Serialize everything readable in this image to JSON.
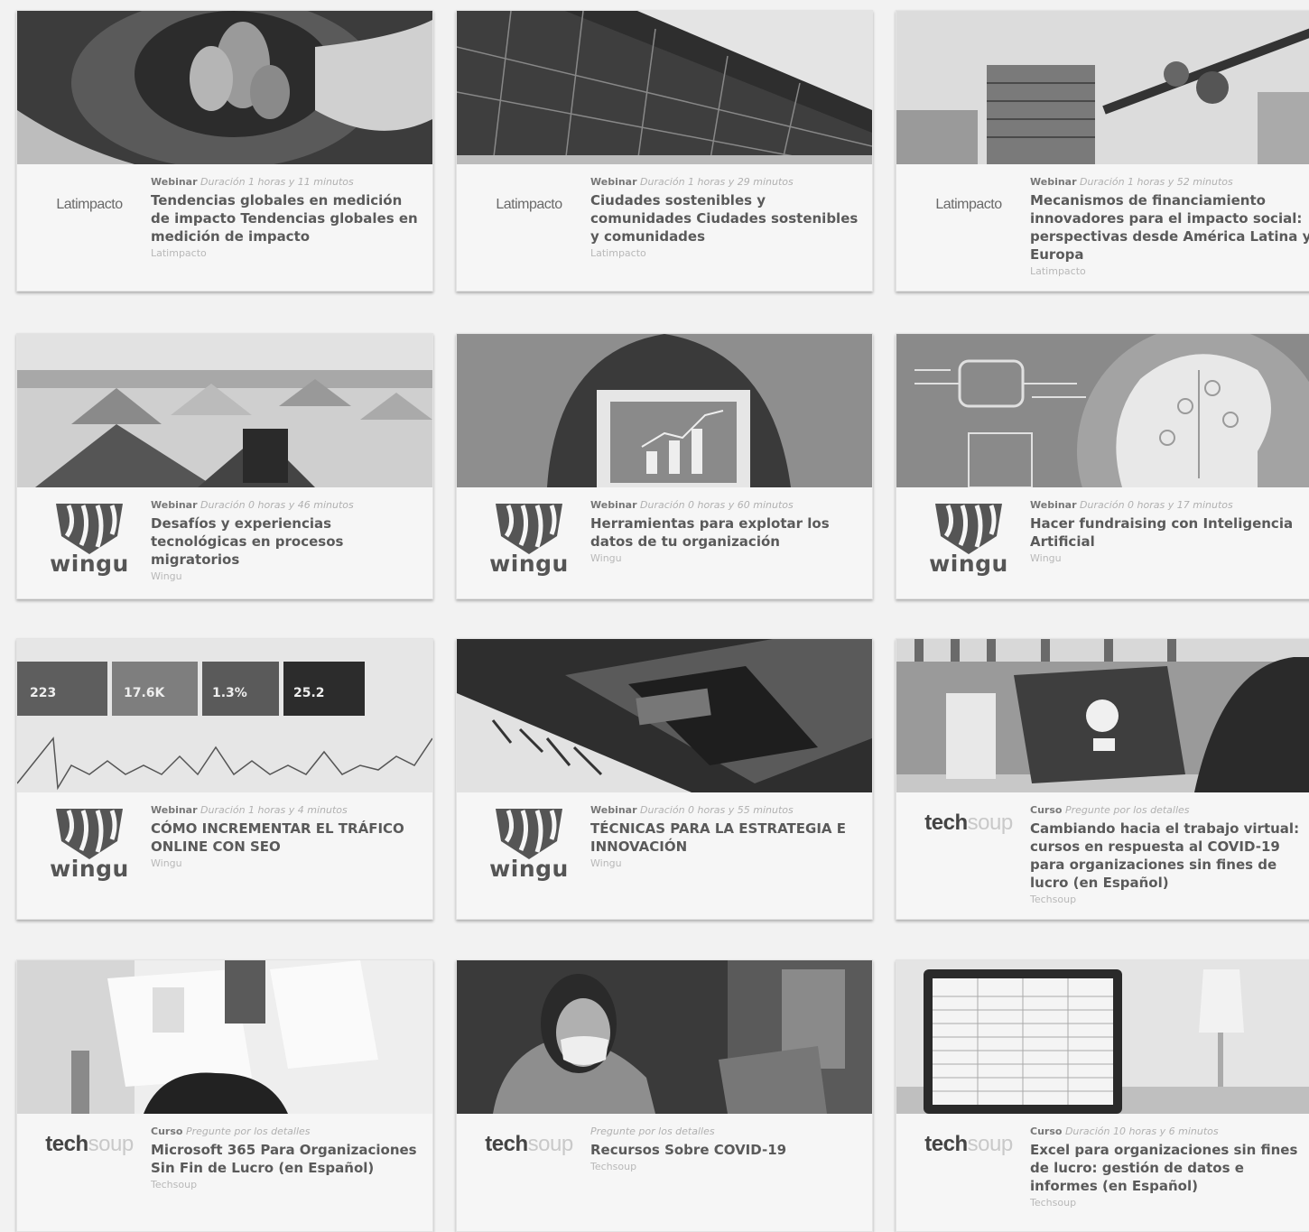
{
  "cards": [
    {
      "type": "Webinar",
      "duration": "Duración 1 horas y 11 minutos",
      "title": "Tendencias globales en medición de impacto Tendencias globales en medición de impacto",
      "org": "Latimpacto",
      "logo_text": "Latimpacto",
      "logo_icon": "latimpacto-logo",
      "image": "hands-soil-plant-photo"
    },
    {
      "type": "Webinar",
      "duration": "Duración 1 horas y 29 minutos",
      "title": "Ciudades sostenibles y comunidades Ciudades sostenibles y comunidades",
      "org": "Latimpacto",
      "logo_text": "Latimpacto",
      "logo_icon": "latimpacto-logo",
      "image": "solar-panels-photo"
    },
    {
      "type": "Webinar",
      "duration": "Duración 1 horas y 52 minutos",
      "title": "Mecanismos de financiamiento innovadores para el impacto social: perspectivas desde América Latina y Europa",
      "org": "Latimpacto",
      "logo_text": "Latimpacto",
      "logo_icon": "latimpacto-logo",
      "image": "coins-stack-photo"
    },
    {
      "type": "Webinar",
      "duration": "Duración 0 horas y 46 minutos",
      "title": "Desafíos y experiencias tecnológicas en procesos migratorios",
      "org": "Wingu",
      "logo_text": "wingu",
      "logo_icon": "wingu-logo",
      "image": "tent-camp-photo"
    },
    {
      "type": "Webinar",
      "duration": "Duración 0 horas y 60 minutos",
      "title": "Herramientas para explotar los datos de tu organización",
      "org": "Wingu",
      "logo_text": "wingu",
      "logo_icon": "wingu-logo",
      "image": "tablet-chart-photo"
    },
    {
      "type": "Webinar",
      "duration": "Duración 0 horas y 17 minutos",
      "title": "Hacer fundraising con Inteligencia Artificial",
      "org": "Wingu",
      "logo_text": "wingu",
      "logo_icon": "wingu-logo",
      "image": "ai-brain-illustration"
    },
    {
      "type": "Webinar",
      "duration": "Duración 1 horas y 4 minutos",
      "title": "CÓMO INCREMENTAR EL TRÁFICO ONLINE CON SEO",
      "org": "Wingu",
      "logo_text": "wingu",
      "logo_icon": "wingu-logo",
      "image": "analytics-dashboard-photo",
      "stats": [
        "223",
        "17.6K",
        "1.3%",
        "25.2"
      ]
    },
    {
      "type": "Webinar",
      "duration": "Duración 0 horas y 55 minutos",
      "title": "TÉCNICAS PARA LA ESTRATEGIA E INNOVACIÓN",
      "org": "Wingu",
      "logo_text": "wingu",
      "logo_icon": "wingu-logo",
      "image": "laptop-appointment-photo"
    },
    {
      "type": "Curso",
      "duration": "Pregunte por los detalles",
      "title": "Cambiando hacia el trabajo virtual: cursos en respuesta al COVID-19 para organizaciones sin fines de lucro (en Español)",
      "org": "Techsoup",
      "logo_text": "techsoup",
      "logo_icon": "techsoup-logo",
      "image": "laptop-vpn-photo"
    },
    {
      "type": "Curso",
      "duration": "Pregunte por los detalles",
      "title": "Microsoft 365 Para Organizaciones Sin Fin de Lucro (en Español)",
      "org": "Techsoup",
      "logo_text": "techsoup",
      "logo_icon": "techsoup-logo",
      "image": "desk-phones-photo"
    },
    {
      "type": "",
      "duration": "Pregunte por los detalles",
      "title": "Recursos Sobre COVID-19",
      "org": "Techsoup",
      "logo_text": "techsoup",
      "logo_icon": "techsoup-logo",
      "image": "woman-mask-photo"
    },
    {
      "type": "Curso",
      "duration": "Duración 10 horas y 6 minutos",
      "title": "Excel para organizaciones sin fines de lucro: gestión de datos e informes (en Español)",
      "org": "Techsoup",
      "logo_text": "techsoup",
      "logo_icon": "techsoup-logo",
      "image": "spreadsheet-monitor-photo"
    }
  ]
}
